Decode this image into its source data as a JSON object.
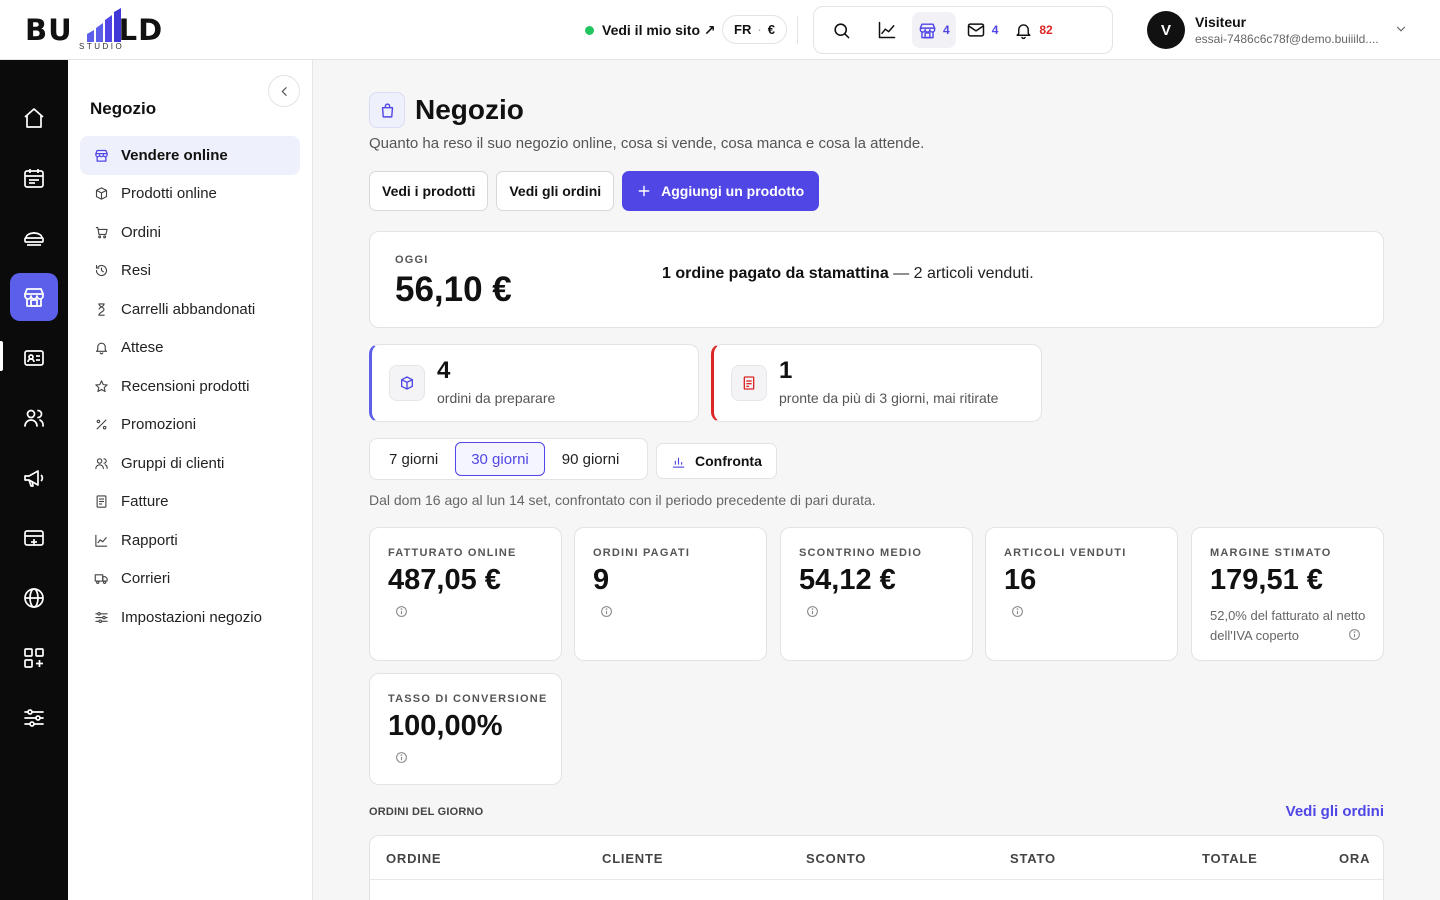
{
  "brand": {
    "logo_left": "BU",
    "logo_right": "LD",
    "logo_sub": "STUDIO"
  },
  "topbar": {
    "site_link": "Vedi il mio sito ↗",
    "lang": "FR",
    "currency": "€",
    "store_count": "4",
    "mail_count": "4",
    "notif_count": "82",
    "user_initial": "V",
    "user_name": "Visiteur",
    "user_email": "essai-7486c6c78f@demo.buiiild...."
  },
  "sidebar": {
    "title": "Negozio",
    "items": [
      {
        "label": "Vendere online",
        "icon": "store-icon",
        "active": true
      },
      {
        "label": "Prodotti online",
        "icon": "box-icon"
      },
      {
        "label": "Ordini",
        "icon": "cart-icon"
      },
      {
        "label": "Resi",
        "icon": "history-icon"
      },
      {
        "label": "Carrelli abbandonati",
        "icon": "hourglass-icon"
      },
      {
        "label": "Attese",
        "icon": "bell-icon"
      },
      {
        "label": "Recensioni prodotti",
        "icon": "star-icon"
      },
      {
        "label": "Promozioni",
        "icon": "percent-icon"
      },
      {
        "label": "Gruppi di clienti",
        "icon": "users-icon"
      },
      {
        "label": "Fatture",
        "icon": "invoice-icon"
      },
      {
        "label": "Rapporti",
        "icon": "chart-icon"
      },
      {
        "label": "Corrieri",
        "icon": "truck-icon"
      },
      {
        "label": "Impostazioni negozio",
        "icon": "settings-icon"
      }
    ]
  },
  "page": {
    "title": "Negozio",
    "subtitle": "Quanto ha reso il suo negozio online, cosa si vende, cosa manca e cosa la attende.",
    "btn_products": "Vedi i prodotti",
    "btn_orders": "Vedi gli ordini",
    "btn_add": "Aggiungi un prodotto"
  },
  "today": {
    "label": "OGGI",
    "value": "56,10 €",
    "msg_bold": "1 ordine pagato da stamattina",
    "msg_rest": " — 2 articoli venduti."
  },
  "alerts": {
    "prep_count": "4",
    "prep_text": "ordini da preparare",
    "ready_count": "1",
    "ready_text": "pronte da più di 3 giorni, mai ritirate"
  },
  "periods": {
    "p7": "7 giorni",
    "p30": "30 giorni",
    "p90": "90 giorni",
    "selected": "30 giorni",
    "compare": "Confronta",
    "note": "Dal dom 16 ago al lun 14 set, confrontato con il periodo precedente di pari durata."
  },
  "kpis": {
    "revenue_label": "FATTURATO ONLINE",
    "revenue_value": "487,05 €",
    "orders_label": "ORDINI PAGATI",
    "orders_value": "9",
    "avg_label": "SCONTRINO MEDIO",
    "avg_value": "54,12 €",
    "items_label": "ARTICOLI VENDUTI",
    "items_value": "16",
    "margin_label": "MARGINE STIMATO",
    "margin_value": "179,51 €",
    "margin_note": "52,0% del fatturato al netto dell'IVA coperto",
    "conv_label": "TASSO DI CONVERSIONE",
    "conv_value": "100,00%"
  },
  "orders": {
    "heading": "ORDINI DEL GIORNO",
    "link": "Vedi gli ordini",
    "columns": [
      "ORDINE",
      "CLIENTE",
      "SCONTO",
      "STATO",
      "TOTALE",
      "ORA"
    ]
  },
  "colors": {
    "accent": "#4f46e5",
    "rail": "#0b0b0c",
    "alert_red": "#dc2626",
    "online": "#22c55e"
  }
}
